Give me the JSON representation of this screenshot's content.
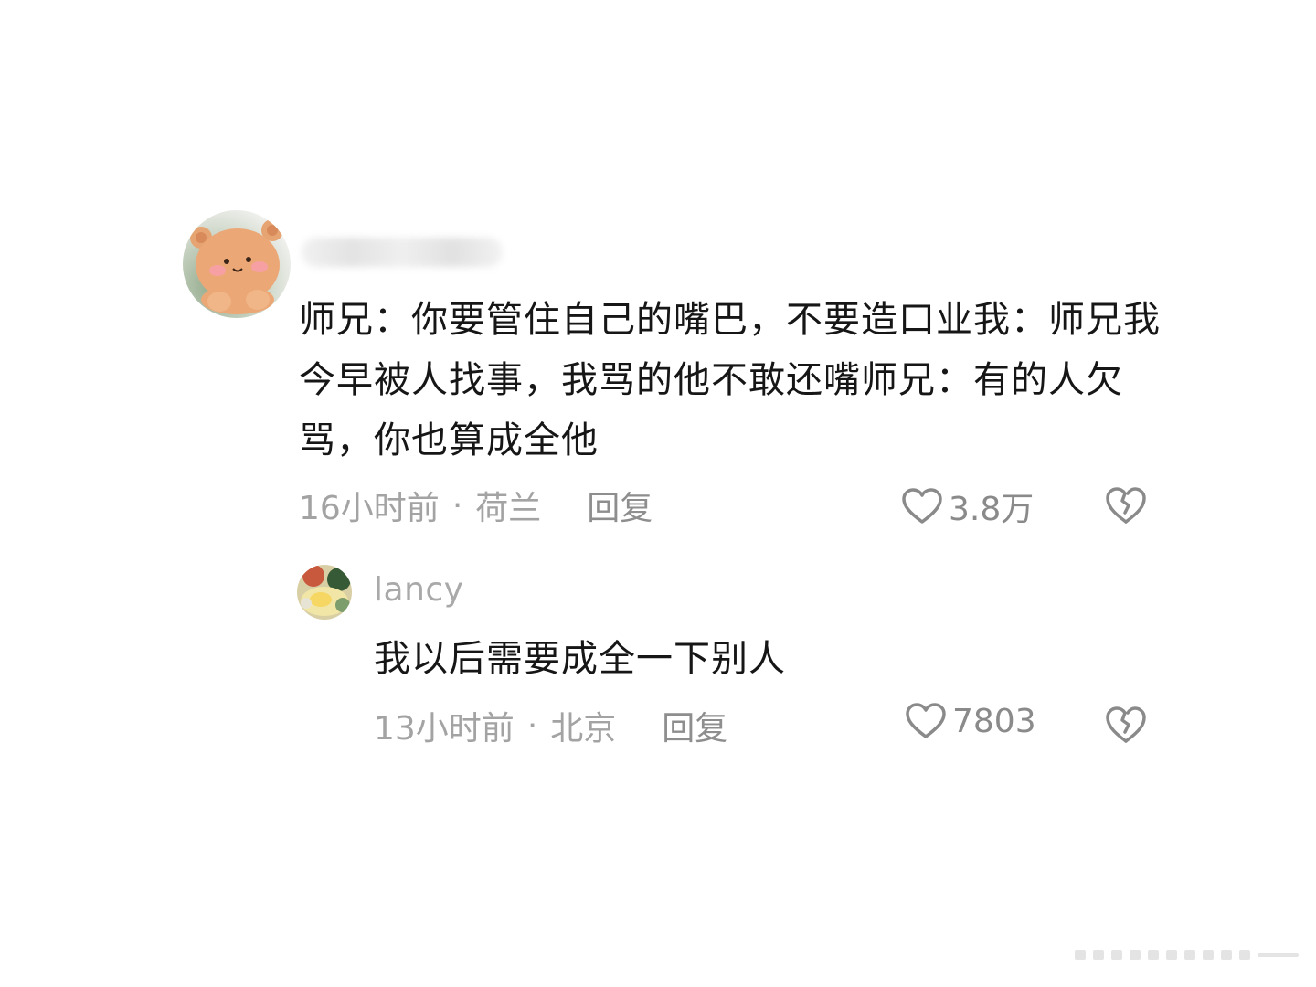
{
  "thread": {
    "comment": {
      "avatar_icon": "teddy-bear-avatar",
      "text": "师兄：你要管住自己的嘴巴，不要造口业我：师兄我今早被人找事，我骂的他不敢还嘴师兄：有的人欠骂，你也算成全他",
      "time": "16小时前",
      "separator": "·",
      "location": "荷兰",
      "reply_label": "回复",
      "likes": "3.8万"
    },
    "reply": {
      "avatar_icon": "food-photo-avatar",
      "username": "lancy",
      "text": "我以后需要成全一下别人",
      "time": "13小时前",
      "separator": "·",
      "location": "北京",
      "reply_label": "回复",
      "likes": "7803"
    }
  },
  "colors": {
    "text": "#161616",
    "meta": "#a3a3a3",
    "divider": "#e6e6e6",
    "icon": "#8a8a8a"
  }
}
